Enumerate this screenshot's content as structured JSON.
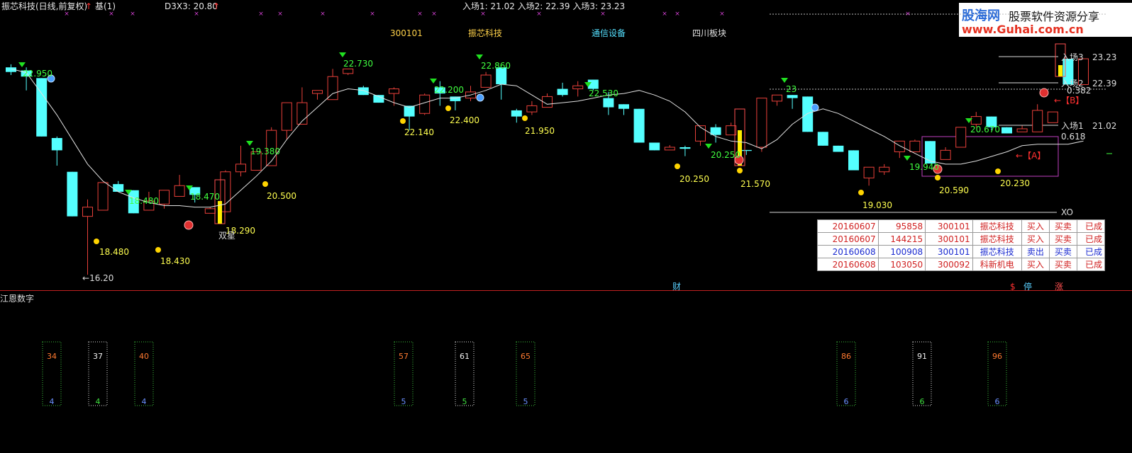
{
  "header": {
    "title": "振芯科技(日线,前复权)",
    "ref_arrow": "↑",
    "ref": "基(1)",
    "d3x3": "D3X3: 20.80",
    "d3x3_arrow": "↑",
    "entries": "入场1: 21.02  入场2: 22.39  入场3: 23.23"
  },
  "info": {
    "code": "300101",
    "name": "振芯科技",
    "industry": "通信设备",
    "region": "四川板块"
  },
  "logo": {
    "brand": "股海网",
    "slogan": "股票软件资源分享",
    "url": "www.Guhai.com.cn"
  },
  "price_axis": {
    "labels": [
      "23.23",
      "22.39",
      "21.02"
    ],
    "entry_tags": [
      "入场3",
      "入场2",
      "入场1"
    ]
  },
  "candles": [
    [
      22.95,
      22.8,
      23.05,
      22.7
    ],
    [
      22.85,
      22.65,
      22.95,
      22.2
    ],
    [
      22.6,
      20.7,
      22.6,
      20.7
    ],
    [
      20.65,
      20.25,
      20.7,
      19.75
    ],
    [
      19.55,
      18.1,
      19.55,
      18.1
    ],
    [
      18.1,
      18.4,
      18.65,
      16.2
    ],
    [
      18.3,
      19.2,
      19.2,
      18.3
    ],
    [
      19.15,
      18.9,
      19.25,
      18.9
    ],
    [
      18.95,
      18.2,
      18.95,
      18.2
    ],
    [
      18.3,
      18.6,
      18.9,
      18.3
    ],
    [
      18.5,
      18.95,
      18.95,
      18.35
    ],
    [
      18.75,
      19.1,
      19.45,
      18.75
    ],
    [
      19.05,
      18.8,
      19.05,
      18.55
    ],
    [
      18.2,
      18.35,
      18.4,
      18.2
    ],
    [
      18.25,
      19.55,
      19.6,
      18.25
    ],
    [
      19.55,
      19.8,
      20.4,
      19.4
    ],
    [
      19.6,
      20.2,
      20.2,
      19.6
    ],
    [
      19.75,
      20.9,
      21.0,
      19.75
    ],
    [
      20.9,
      21.8,
      21.8,
      20.6
    ],
    [
      21.1,
      21.8,
      22.3,
      21.1
    ],
    [
      22.1,
      22.2,
      22.2,
      21.9
    ],
    [
      21.9,
      22.65,
      22.9,
      21.9
    ],
    [
      22.75,
      22.9,
      22.9,
      22.7
    ],
    [
      22.3,
      22.05,
      22.35,
      22.05
    ],
    [
      22.05,
      21.8,
      22.05,
      21.8
    ],
    [
      22.1,
      22.25,
      22.3,
      21.7
    ],
    [
      21.7,
      21.35,
      21.7,
      20.9
    ],
    [
      21.45,
      22.05,
      22.1,
      21.4
    ],
    [
      22.3,
      22.1,
      22.5,
      21.7
    ],
    [
      22.0,
      21.85,
      22.0,
      21.55
    ],
    [
      21.95,
      22.15,
      22.35,
      21.85
    ],
    [
      22.3,
      22.7,
      22.8,
      22.3
    ],
    [
      22.95,
      22.4,
      22.95,
      21.9
    ],
    [
      21.55,
      21.35,
      21.6,
      21.15
    ],
    [
      21.5,
      21.7,
      21.85,
      21.4
    ],
    [
      21.65,
      22.0,
      22.1,
      21.65
    ],
    [
      22.25,
      22.05,
      22.45,
      22.0
    ],
    [
      22.25,
      22.35,
      22.5,
      22.0
    ],
    [
      22.55,
      22.25,
      22.55,
      22.2
    ],
    [
      21.95,
      21.65,
      22.15,
      21.4
    ],
    [
      21.75,
      21.6,
      21.75,
      21.4
    ],
    [
      21.6,
      20.5,
      21.6,
      20.5
    ],
    [
      20.5,
      20.25,
      20.5,
      20.25
    ],
    [
      20.26,
      20.35,
      20.42,
      20.26
    ],
    [
      20.35,
      20.3,
      20.4,
      20.06
    ],
    [
      20.55,
      21.05,
      21.05,
      20.4
    ],
    [
      21.0,
      20.75,
      21.1,
      20.5
    ],
    [
      20.75,
      21.05,
      21.15,
      20.75
    ],
    [
      20.26,
      20.23,
      20.26,
      20.1
    ],
    [
      20.35,
      21.95,
      21.95,
      20.2
    ],
    [
      21.85,
      22.05,
      22.05,
      21.7
    ],
    [
      22.05,
      21.95,
      22.05,
      21.6
    ],
    [
      22.0,
      20.85,
      22.0,
      20.85
    ],
    [
      20.85,
      20.4,
      20.85,
      20.4
    ],
    [
      20.4,
      20.2,
      20.4,
      20.2
    ],
    [
      20.25,
      19.6,
      20.25,
      19.6
    ],
    [
      19.35,
      19.7,
      19.7,
      19.1
    ],
    [
      19.55,
      19.7,
      19.8,
      19.45
    ],
    [
      20.2,
      20.55,
      20.55,
      20.0
    ],
    [
      20.2,
      20.55,
      20.6,
      20.2
    ],
    [
      20.55,
      19.82,
      20.55,
      19.82
    ],
    [
      19.95,
      20.25,
      20.35,
      19.95
    ],
    [
      20.35,
      21.0,
      21.0,
      20.35
    ],
    [
      21.1,
      21.35,
      21.5,
      21.0
    ],
    [
      21.35,
      21.0,
      21.35,
      20.9
    ],
    [
      21.0,
      20.8,
      21.0,
      20.8
    ],
    [
      20.85,
      20.95,
      21.05,
      20.85
    ],
    [
      20.85,
      21.55,
      21.75,
      20.85
    ],
    [
      21.15,
      21.5,
      21.5,
      21.15
    ],
    [
      23.23,
      22.39,
      23.23,
      22.39
    ],
    [
      22.39,
      23.23,
      23.23,
      22.39
    ]
  ],
  "ma_line": [
    22.9,
    22.78,
    22.1,
    21.4,
    20.6,
    19.8,
    19.25,
    18.9,
    18.7,
    18.55,
    18.45,
    18.45,
    18.4,
    18.4,
    18.5,
    18.95,
    19.4,
    19.9,
    20.6,
    21.2,
    21.65,
    22.1,
    22.25,
    22.2,
    22.0,
    21.8,
    21.65,
    21.8,
    21.95,
    21.95,
    22.05,
    22.2,
    22.4,
    22.35,
    22.05,
    21.75,
    21.8,
    21.85,
    21.95,
    22.05,
    22.1,
    22.2,
    22.05,
    21.85,
    21.5,
    21.0,
    20.7,
    20.55,
    20.5,
    20.3,
    20.6,
    21.1,
    21.45,
    21.6,
    21.45,
    21.2,
    20.95,
    20.7,
    20.4,
    20.15,
    19.9,
    19.8,
    19.8,
    19.9,
    20.05,
    20.2,
    20.4,
    20.45,
    20.45,
    20.45,
    20.55
  ],
  "price_labels": [
    "22.950",
    "18.480",
    "18.470",
    "19.380",
    "22.730",
    "22.200",
    "22.860",
    "22.530",
    "20.250",
    "23",
    "19.940",
    "20.670",
    "18.480",
    "18.430",
    "18.290",
    "20.500",
    "22.140",
    "22.400",
    "21.950",
    "20.250",
    "21.570",
    "19.030",
    "20.590",
    "20.230",
    "16.20",
    "0.618",
    "0.382",
    "XO"
  ],
  "annotations": {
    "shuangxing": "双星",
    "mark_b": "【B】",
    "mark_a": "【A】"
  },
  "trades_table": [
    {
      "date": "20160607",
      "time": "95858",
      "code": "300101",
      "name": "振芯科技",
      "action": "买入",
      "type": "买卖",
      "status": "已成",
      "color": "#d02020"
    },
    {
      "date": "20160607",
      "time": "144215",
      "code": "300101",
      "name": "振芯科技",
      "action": "买入",
      "type": "买卖",
      "status": "已成",
      "color": "#d02020"
    },
    {
      "date": "20160608",
      "time": "100908",
      "code": "300101",
      "name": "振芯科技",
      "action": "卖出",
      "type": "买卖",
      "status": "已成",
      "color": "#1a2ad0"
    },
    {
      "date": "20160608",
      "time": "103050",
      "code": "300092",
      "name": "科新机电",
      "action": "买入",
      "type": "买卖",
      "status": "已成",
      "color": "#d02020"
    }
  ],
  "bottom_marks": {
    "cai": "财",
    "dollar": "$",
    "ting": "停",
    "zhang": "涨"
  },
  "indicator": {
    "title": "江恩数字",
    "boxes": [
      {
        "top": "34",
        "bottom": "4",
        "white": false
      },
      {
        "top": "37",
        "bottom": "4",
        "white": true
      },
      {
        "top": "40",
        "bottom": "4",
        "white": false
      },
      {
        "top": "57",
        "bottom": "5",
        "white": false
      },
      {
        "top": "61",
        "bottom": "5",
        "white": true
      },
      {
        "top": "65",
        "bottom": "5",
        "white": false
      },
      {
        "top": "86",
        "bottom": "6",
        "white": false
      },
      {
        "top": "91",
        "bottom": "6",
        "white": true
      },
      {
        "top": "96",
        "bottom": "6",
        "white": false
      }
    ]
  },
  "colors": {
    "up": "#e8403a",
    "down": "#54ffff",
    "ma": "#e0e0e0",
    "label_green": "#40ff40",
    "label_yellow": "#ffff50",
    "dot": "#ffd400"
  }
}
